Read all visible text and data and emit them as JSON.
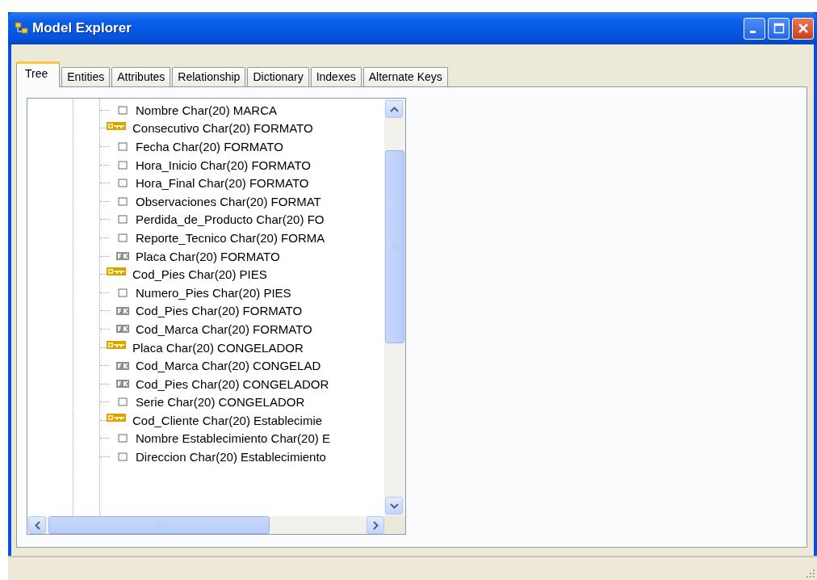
{
  "window": {
    "title": "Model Explorer"
  },
  "tabs": [
    {
      "label": "Tree",
      "selected": true
    },
    {
      "label": "Entities",
      "selected": false
    },
    {
      "label": "Attributes",
      "selected": false
    },
    {
      "label": "Relationship",
      "selected": false
    },
    {
      "label": "Dictionary",
      "selected": false
    },
    {
      "label": "Indexes",
      "selected": false
    },
    {
      "label": "Alternate Keys",
      "selected": false
    }
  ],
  "tree": {
    "items": [
      {
        "kind": "attribute",
        "label": "Nombre Char(20)  MARCA"
      },
      {
        "kind": "key",
        "label": "Consecutivo Char(20)  FORMATO"
      },
      {
        "kind": "attribute",
        "label": "Fecha Char(20)  FORMATO"
      },
      {
        "kind": "attribute",
        "label": "Hora_Inicio Char(20)  FORMATO"
      },
      {
        "kind": "attribute",
        "label": "Hora_Final Char(20)  FORMATO"
      },
      {
        "kind": "attribute",
        "label": "Observaciones Char(20)  FORMAT"
      },
      {
        "kind": "attribute",
        "label": "Perdida_de_Producto Char(20)  FO"
      },
      {
        "kind": "attribute",
        "label": "Reporte_Tecnico Char(20)  FORMA"
      },
      {
        "kind": "foreign_key",
        "label": "Placa Char(20)  FORMATO"
      },
      {
        "kind": "key",
        "label": "Cod_Pies Char(20)  PIES"
      },
      {
        "kind": "attribute",
        "label": "Numero_Pies Char(20)  PIES"
      },
      {
        "kind": "foreign_key",
        "label": "Cod_Pies Char(20)  FORMATO"
      },
      {
        "kind": "foreign_key",
        "label": "Cod_Marca Char(20)  FORMATO"
      },
      {
        "kind": "key",
        "label": "Placa Char(20)  CONGELADOR"
      },
      {
        "kind": "foreign_key",
        "label": "Cod_Marca Char(20)  CONGELAD"
      },
      {
        "kind": "foreign_key",
        "label": "Cod_Pies Char(20)  CONGELADOR"
      },
      {
        "kind": "attribute",
        "label": "Serie Char(20)  CONGELADOR"
      },
      {
        "kind": "key",
        "label": "Cod_Cliente Char(20)  Establecimie"
      },
      {
        "kind": "attribute",
        "label": "Nombre Establecimiento Char(20)  E"
      },
      {
        "kind": "attribute",
        "label": "Direccion Char(20)  Establecimiento"
      }
    ]
  }
}
